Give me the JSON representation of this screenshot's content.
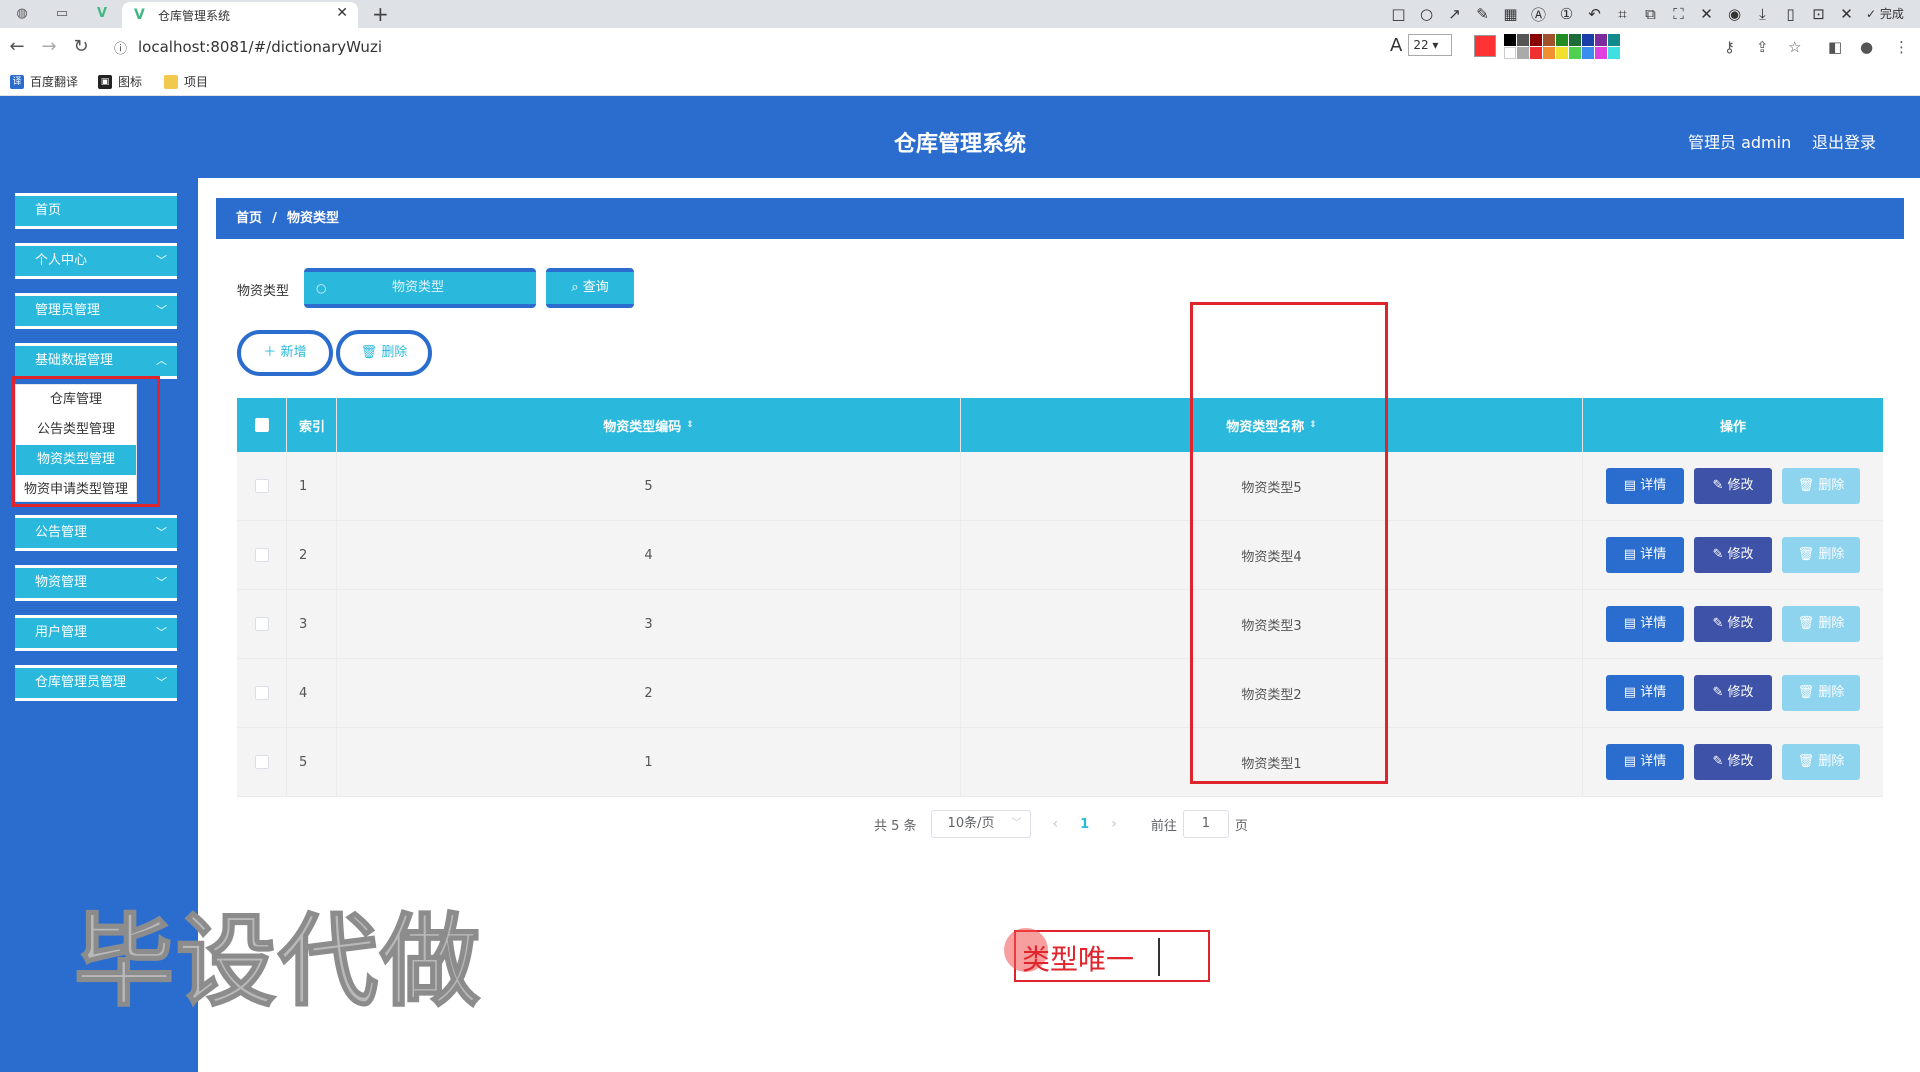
{
  "browser": {
    "tab_title": "仓库管理系统",
    "url": "localhost:8081/#/dictionaryWuzi",
    "font_size": "22",
    "done_label": "完成",
    "bookmarks": [
      "百度翻译",
      "图标",
      "项目"
    ]
  },
  "header": {
    "title": "仓库管理系统",
    "user": "管理员 admin",
    "logout": "退出登录"
  },
  "sidebar": {
    "items": [
      {
        "label": "首页"
      },
      {
        "label": "个人中心"
      },
      {
        "label": "管理员管理"
      },
      {
        "label": "基础数据管理"
      },
      {
        "label": "公告管理"
      },
      {
        "label": "物资管理"
      },
      {
        "label": "用户管理"
      },
      {
        "label": "仓库管理员管理"
      }
    ],
    "submenu": [
      "仓库管理",
      "公告类型管理",
      "物资类型管理",
      "物资申请类型管理"
    ]
  },
  "breadcrumb": {
    "home": "首页",
    "separator": "/",
    "current": "物资类型"
  },
  "search": {
    "label": "物资类型",
    "placeholder": "物资类型",
    "button": "查询"
  },
  "actions": {
    "add": "新增",
    "delete": "删除"
  },
  "table": {
    "headers": {
      "index": "索引",
      "code": "物资类型编码",
      "name": "物资类型名称",
      "ops": "操作"
    },
    "rows": [
      {
        "index": "1",
        "code": "5",
        "name": "物资类型5"
      },
      {
        "index": "2",
        "code": "4",
        "name": "物资类型4"
      },
      {
        "index": "3",
        "code": "3",
        "name": "物资类型3"
      },
      {
        "index": "4",
        "code": "2",
        "name": "物资类型2"
      },
      {
        "index": "5",
        "code": "1",
        "name": "物资类型1"
      }
    ],
    "row_buttons": {
      "detail": "详情",
      "edit": "修改",
      "delete": "删除"
    }
  },
  "pagination": {
    "total": "共 5 条",
    "page_size": "10条/页",
    "current": "1",
    "goto": "前往",
    "goto_value": "1",
    "page_suffix": "页"
  },
  "watermark": "毕设代做",
  "annotation": "类型唯一",
  "colors": {
    "header_blue": "#2a6dcf",
    "accent_cyan": "#2ab9dc",
    "edit_indigo": "#3e52a8",
    "annotation_red": "#e0242b"
  }
}
